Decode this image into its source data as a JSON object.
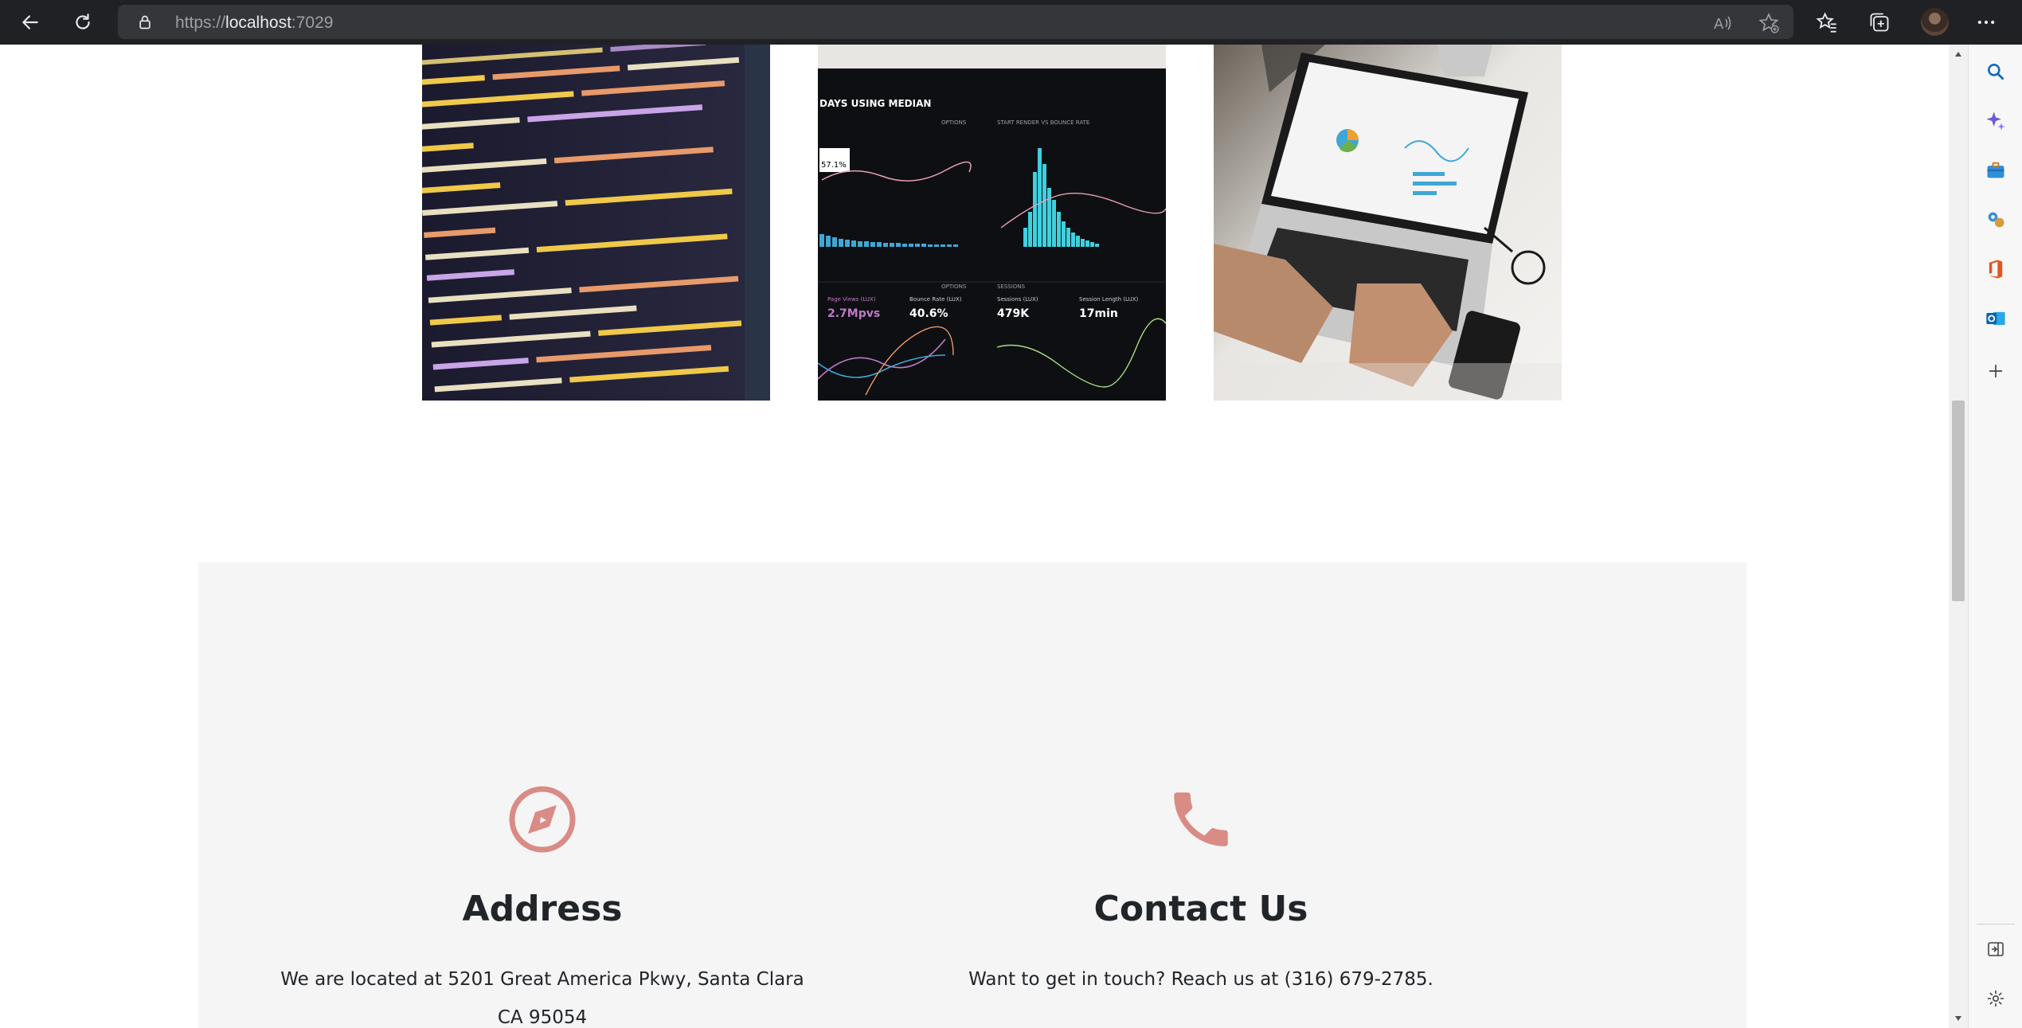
{
  "browser": {
    "url_prefix": "https://",
    "url_host": "localhost",
    "url_port": ":7029"
  },
  "gallery": {
    "images": [
      {
        "name": "code-screen-image"
      },
      {
        "name": "analytics-dashboard-image"
      },
      {
        "name": "laptop-typing-image"
      }
    ],
    "dashboard_labels": {
      "header": "DAYS USING MEDIAN",
      "options": "OPTIONS",
      "start_render": "START RENDER VS BOUNCE RATE",
      "bounce_box": "57.1%",
      "pv_label": "Page Views (LUX)",
      "pv_value": "2.7Mpvs",
      "br_label": "Bounce Rate (LUX)",
      "br_value": "40.6%",
      "sessions_label": "Sessions (LUX)",
      "sessions_value": "479K",
      "length_label": "Session Length (LUX)",
      "length_value": "17min",
      "sessions_head": "SESSIONS"
    }
  },
  "info": {
    "address": {
      "title": "Address",
      "line1": "We are located at 5201 Great America Pkwy, Santa Clara",
      "line2": "CA 95054"
    },
    "contact": {
      "title": "Contact Us",
      "text": "Want to get in touch? Reach us at (316) 679-2785."
    }
  },
  "colors": {
    "accent": "#d98b86",
    "section_bg": "#f5f5f5"
  },
  "icons": {
    "address": "compass-icon",
    "contact": "phone-icon"
  }
}
